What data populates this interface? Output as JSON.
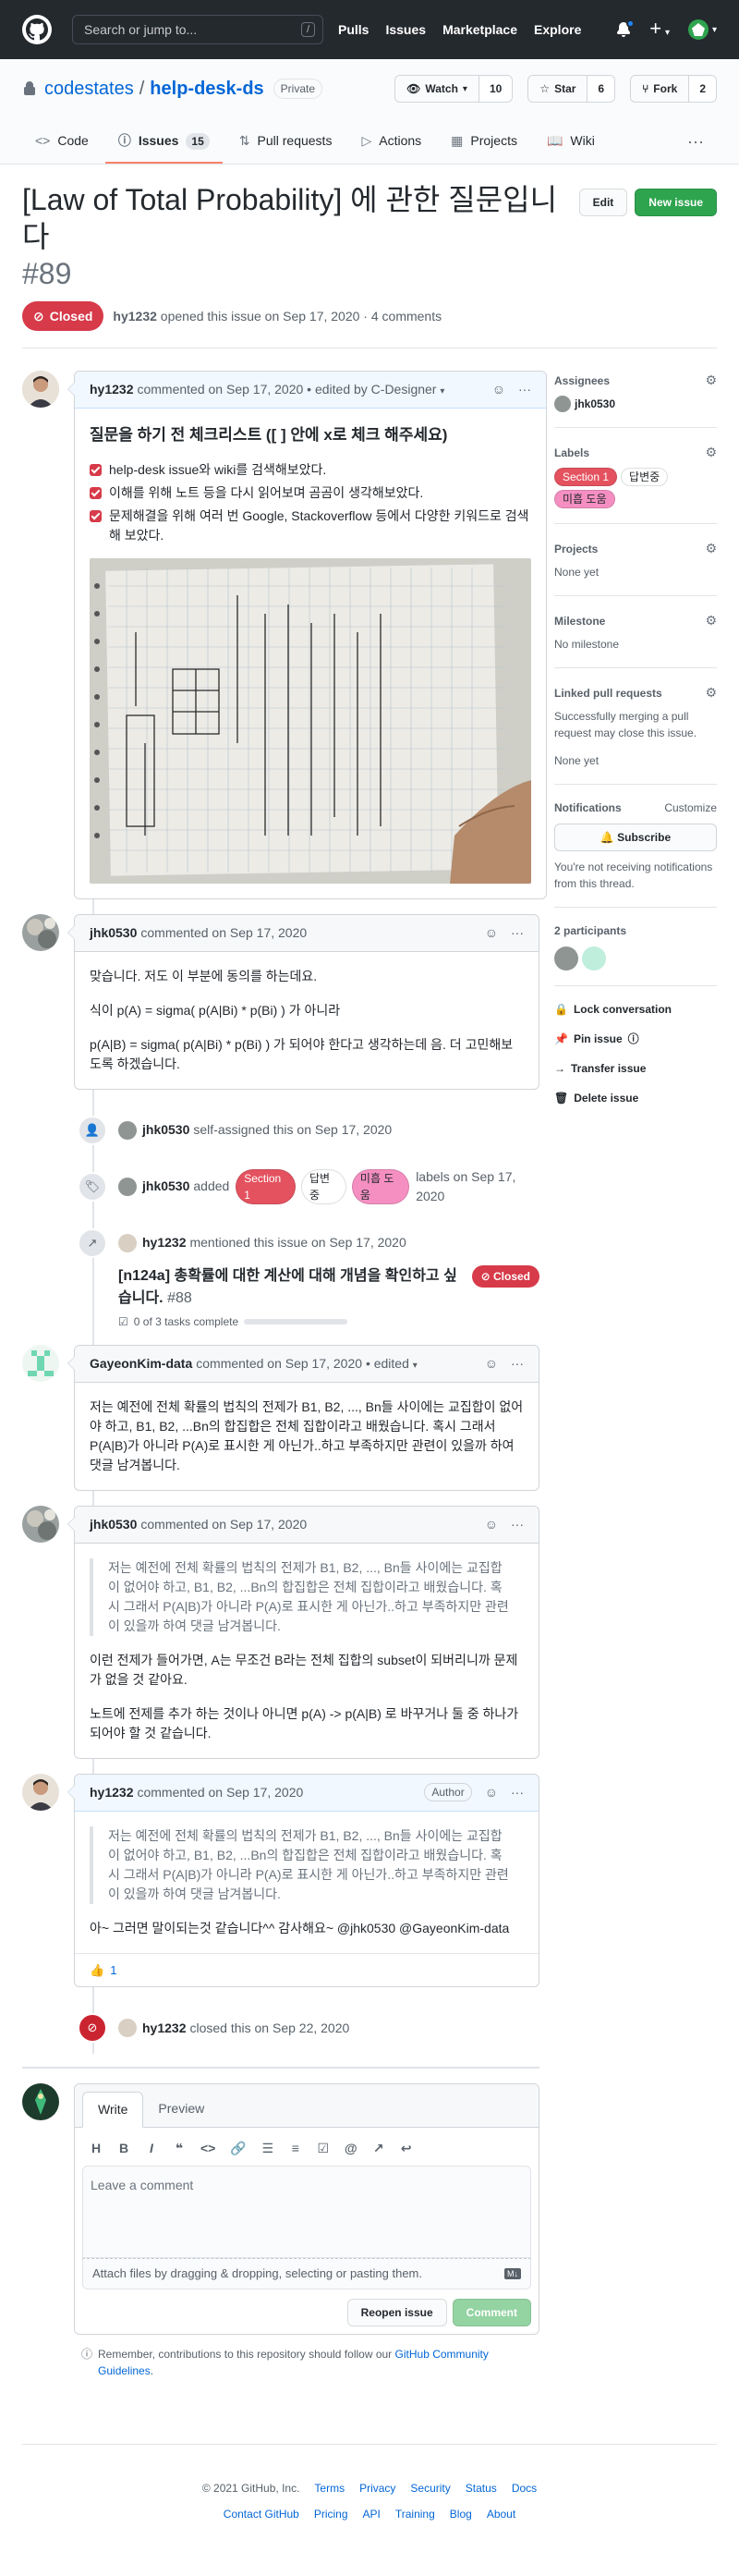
{
  "header": {
    "search_placeholder": "Search or jump to...",
    "search_shortcut": "/",
    "nav": [
      "Pulls",
      "Issues",
      "Marketplace",
      "Explore"
    ]
  },
  "repo": {
    "owner": "codestates",
    "sep": "/",
    "name": "help-desk-ds",
    "visibility": "Private",
    "watch_label": "Watch",
    "watch_count": "10",
    "star_label": "Star",
    "star_count": "6",
    "fork_label": "Fork",
    "fork_count": "2"
  },
  "tabs": {
    "code": "Code",
    "issues": "Issues",
    "issues_count": "15",
    "pulls": "Pull requests",
    "actions": "Actions",
    "projects": "Projects",
    "wiki": "Wiki"
  },
  "issue": {
    "title": "[Law of Total Probability] 에 관한 질문입니다",
    "number": "#89",
    "edit_label": "Edit",
    "new_issue_label": "New issue",
    "state": "Closed",
    "author": "hy1232",
    "meta": "opened this issue on Sep 17, 2020 · 4 comments"
  },
  "comments": {
    "c1": {
      "author": "hy1232",
      "meta": "commented on Sep 17, 2020",
      "edited": "• edited by C-Designer",
      "heading": "질문을 하기 전 체크리스트 ([ ] 안에 x로 체크 해주세요)",
      "checks": [
        "help-desk issue와 wiki를 검색해보았다.",
        "이해를 위해 노트 등을 다시 읽어보며 곰곰이 생각해보았다.",
        "문제해결을 위해 여러 번 Google, Stackoverflow 등에서 다양한 키워드로 검색해 보았다."
      ]
    },
    "c2": {
      "author": "jhk0530",
      "meta": "commented on Sep 17, 2020",
      "p1": "맞습니다. 저도 이 부분에 동의를 하는데요.",
      "p2": "식이 p(A) = sigma( p(A|Bi) * p(Bi) ) 가 아니라",
      "p3": "p(A|B) = sigma( p(A|Bi) * p(Bi) ) 가 되어야 한다고 생각하는데 음. 더 고민해보도록 하겠습니다."
    },
    "c3": {
      "author": "GayeonKim-data",
      "meta": "commented on Sep 17, 2020",
      "edited": "• edited",
      "p1": "저는 예전에 전체 확률의 법칙의 전제가 B1, B2, ..., Bn들 사이에는 교집합이 없어야 하고, B1, B2, ...Bn의 합집합은 전체 집합이라고 배웠습니다. 혹시 그래서 P(A|B)가 아니라 P(A)로 표시한 게 아닌가..하고 부족하지만 관련이 있을까 하여 댓글 남겨봅니다."
    },
    "c4": {
      "author": "jhk0530",
      "meta": "commented on Sep 17, 2020",
      "quote": "저는 예전에 전체 확률의 법칙의 전제가 B1, B2, ..., Bn들 사이에는 교집합이 없어야 하고, B1, B2, ...Bn의 합집합은 전체 집합이라고 배웠습니다. 혹시 그래서 P(A|B)가 아니라 P(A)로 표시한 게 아닌가..하고 부족하지만 관련이 있을까 하여 댓글 남겨봅니다.",
      "p1": "이런 전제가 들어가면, A는 무조건 B라는 전체 집합의 subset이 되버리니까 문제가 없을 것 같아요.",
      "p2": "노트에 전제를 추가 하는 것이나 아니면 p(A) -> p(A|B) 로 바꾸거나 둘 중 하나가 되어야 할 것 같습니다."
    },
    "c5": {
      "author": "hy1232",
      "meta": "commented on Sep 17, 2020",
      "author_tag": "Author",
      "quote": "저는 예전에 전체 확률의 법칙의 전제가 B1, B2, ..., Bn들 사이에는 교집합이 없어야 하고, B1, B2, ...Bn의 합집합은 전체 집합이라고 배웠습니다. 혹시 그래서 P(A|B)가 아니라 P(A)로 표시한 게 아닌가..하고 부족하지만 관련이 있을까 하여 댓글 남겨봅니다.",
      "p1": "아~ 그러면 말이되는것 같습니다^^ 감사해요~ @jhk0530 @GayeonKim-data",
      "reaction_emoji": "👍",
      "reaction_count": "1"
    }
  },
  "events": {
    "assign": {
      "user": "jhk0530",
      "text": "self-assigned this on Sep 17, 2020"
    },
    "label": {
      "user": "jhk0530",
      "pre": "added",
      "post": "labels on Sep 17, 2020"
    },
    "mention": {
      "user": "hy1232",
      "text": "mentioned this issue on Sep 17, 2020",
      "ref_title": "[n124a] 총확률에 대한 계산에 대해 개념을 확인하고 싶습니다.",
      "ref_number": "#88",
      "ref_state": "Closed",
      "ref_tasks": "0 of 3 tasks complete"
    },
    "close": {
      "user": "hy1232",
      "text": "closed this on Sep 22, 2020"
    }
  },
  "labels": [
    {
      "name": "Section 1",
      "color": "#e4525f",
      "text_color": "#ffffff"
    },
    {
      "name": "답변중",
      "color": "#ffffff",
      "text_color": "#24292e"
    },
    {
      "name": "미흡 도움",
      "color": "#f58fc2",
      "text_color": "#24292e"
    }
  ],
  "new_comment": {
    "write_tab": "Write",
    "preview_tab": "Preview",
    "placeholder": "Leave a comment",
    "attach_text": "Attach files by dragging & dropping, selecting or pasting them.",
    "reopen_label": "Reopen issue",
    "comment_label": "Comment",
    "tip_pre": "Remember, contributions to this repository should follow our",
    "tip_link": "GitHub Community Guidelines",
    "tip_post": "."
  },
  "sidebar": {
    "assignees_title": "Assignees",
    "assignee": "jhk0530",
    "labels_title": "Labels",
    "projects_title": "Projects",
    "projects_value": "None yet",
    "milestone_title": "Milestone",
    "milestone_value": "No milestone",
    "linked_title": "Linked pull requests",
    "linked_desc": "Successfully merging a pull request may close this issue.",
    "linked_value": "None yet",
    "notif_title": "Notifications",
    "notif_customize": "Customize",
    "subscribe_label": "Subscribe",
    "notif_desc": "You're not receiving notifications from this thread.",
    "participants": "2 participants",
    "lock": "Lock conversation",
    "pin": "Pin issue",
    "transfer": "Transfer issue",
    "delete": "Delete issue"
  },
  "footer": {
    "copyright": "© 2021 GitHub, Inc.",
    "row1": [
      "Terms",
      "Privacy",
      "Security",
      "Status",
      "Docs"
    ],
    "row2": [
      "Contact GitHub",
      "Pricing",
      "API",
      "Training",
      "Blog",
      "About"
    ]
  }
}
